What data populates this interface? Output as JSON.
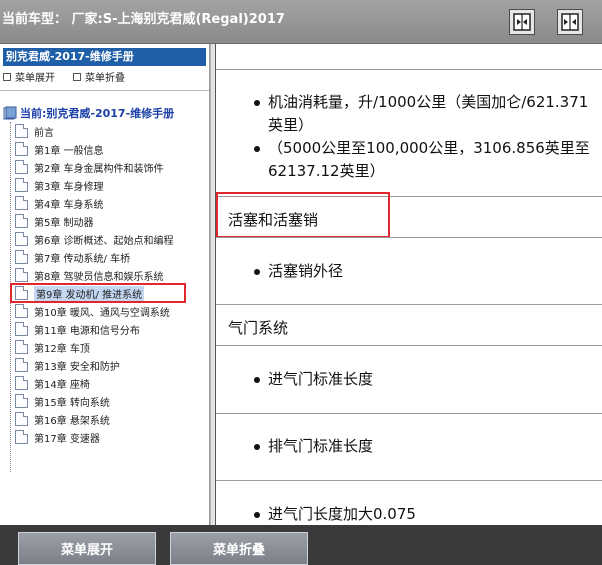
{
  "header": {
    "title": "当前车型： 厂家:S-上海别克君威(Regal)2017",
    "buttons": [
      "collapse-left-icon",
      "expand-split-icon"
    ]
  },
  "sidebar": {
    "manual_title": "别克君威-2017-维修手册",
    "expand_label": "菜单展开",
    "collapse_label": "菜单折叠",
    "root_label": "当前:别克君威-2017-维修手册",
    "items": [
      {
        "label": "前言"
      },
      {
        "label": "第1章 一般信息"
      },
      {
        "label": "第2章 车身金属构件和装饰件"
      },
      {
        "label": "第3章 车身修理"
      },
      {
        "label": "第4章 车身系统"
      },
      {
        "label": "第5章 制动器"
      },
      {
        "label": "第6章 诊断概述、起始点和编程"
      },
      {
        "label": "第7章 传动系统/ 车桥"
      },
      {
        "label": "第8章 驾驶员信息和娱乐系统"
      },
      {
        "label": "第9章 发动机/ 推进系统",
        "selected": true
      },
      {
        "label": "第10章 暖风、通风与空调系统"
      },
      {
        "label": "第11章 电源和信号分布"
      },
      {
        "label": "第12章 车顶"
      },
      {
        "label": "第13章 安全和防护"
      },
      {
        "label": "第14章 座椅"
      },
      {
        "label": "第15章 转向系统"
      },
      {
        "label": "第16章 悬架系统"
      },
      {
        "label": "第17章 变速器"
      }
    ]
  },
  "content": {
    "oil_consumption": "机油消耗量，升/1000公里（美国加仑/621.371英里）",
    "oil_range": "（5000公里至100,000公里，3106.856英里至62137.12英里）",
    "section_piston": "活塞和活塞销",
    "piston_pin_od": "活塞销外径",
    "section_valve": "气门系统",
    "intake_valve_length": "进气门标准长度",
    "exhaust_valve_length": "排气门标准长度",
    "intake_valve_oversize": "进气门长度加大0.075"
  },
  "footer": {
    "expand_button": "菜单展开",
    "collapse_button": "菜单折叠"
  },
  "colors": {
    "highlight": "#e0282c",
    "sidebar_header": "#1f5fa8",
    "root_text": "#1b3fa6"
  }
}
